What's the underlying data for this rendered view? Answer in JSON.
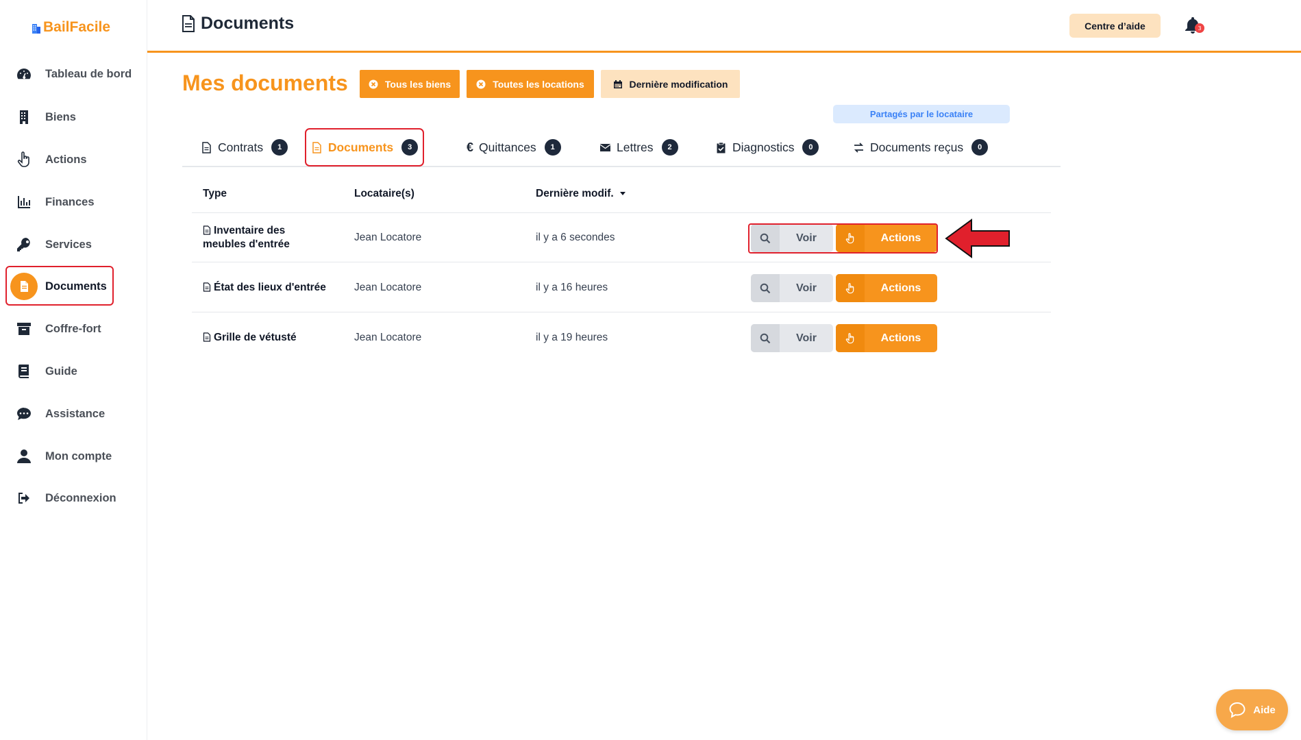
{
  "app": {
    "logo_text": "BailFacile"
  },
  "sidebar": {
    "items": [
      {
        "label": "Tableau de bord",
        "icon": "dashboard-icon"
      },
      {
        "label": "Biens",
        "icon": "building-icon"
      },
      {
        "label": "Actions",
        "icon": "hand-pointer-icon"
      },
      {
        "label": "Finances",
        "icon": "chart-icon"
      },
      {
        "label": "Services",
        "icon": "key-icon"
      },
      {
        "label": "Documents",
        "icon": "document-icon",
        "active": true
      },
      {
        "label": "Coffre-fort",
        "icon": "archive-icon"
      },
      {
        "label": "Guide",
        "icon": "book-icon"
      },
      {
        "label": "Assistance",
        "icon": "chat-icon"
      },
      {
        "label": "Mon compte",
        "icon": "user-icon"
      },
      {
        "label": "Déconnexion",
        "icon": "sign-out-icon"
      }
    ]
  },
  "header": {
    "title": "Documents",
    "help_center_label": "Centre d’aide",
    "notifications_count": "3"
  },
  "main": {
    "title": "Mes documents",
    "filters": [
      {
        "label": "Tous les biens",
        "style": "orange"
      },
      {
        "label": "Toutes les locations",
        "style": "orange"
      },
      {
        "label": "Dernière modification",
        "style": "light"
      }
    ],
    "shared_badge": "Partagés par le locataire",
    "tabs": [
      {
        "label": "Contrats",
        "count": "1",
        "icon": "file-icon"
      },
      {
        "label": "Documents",
        "count": "3",
        "icon": "file-icon",
        "active": true
      },
      {
        "label": "Quittances",
        "count": "1",
        "icon": "euro-icon"
      },
      {
        "label": "Lettres",
        "count": "2",
        "icon": "envelope-icon"
      },
      {
        "label": "Diagnostics",
        "count": "0",
        "icon": "clipboard-icon"
      },
      {
        "label": "Documents reçus",
        "count": "0",
        "icon": "exchange-icon"
      }
    ],
    "table": {
      "columns": [
        "Type",
        "Locataire(s)",
        "Dernière modif."
      ],
      "rows": [
        {
          "type": "Inventaire des meubles d'entrée",
          "tenant": "Jean Locatore",
          "modified": "il y a 6 secondes"
        },
        {
          "type": "État des lieux d'entrée",
          "tenant": "Jean Locatore",
          "modified": "il y a 16 heures"
        },
        {
          "type": "Grille de vétusté",
          "tenant": "Jean Locatore",
          "modified": "il y a 19 heures"
        }
      ],
      "view_label": "Voir",
      "actions_label": "Actions"
    }
  },
  "help_fab_label": "Aide",
  "colors": {
    "accent": "#f7941d",
    "highlight": "#e0202c",
    "dark_badge": "#1e293b"
  }
}
